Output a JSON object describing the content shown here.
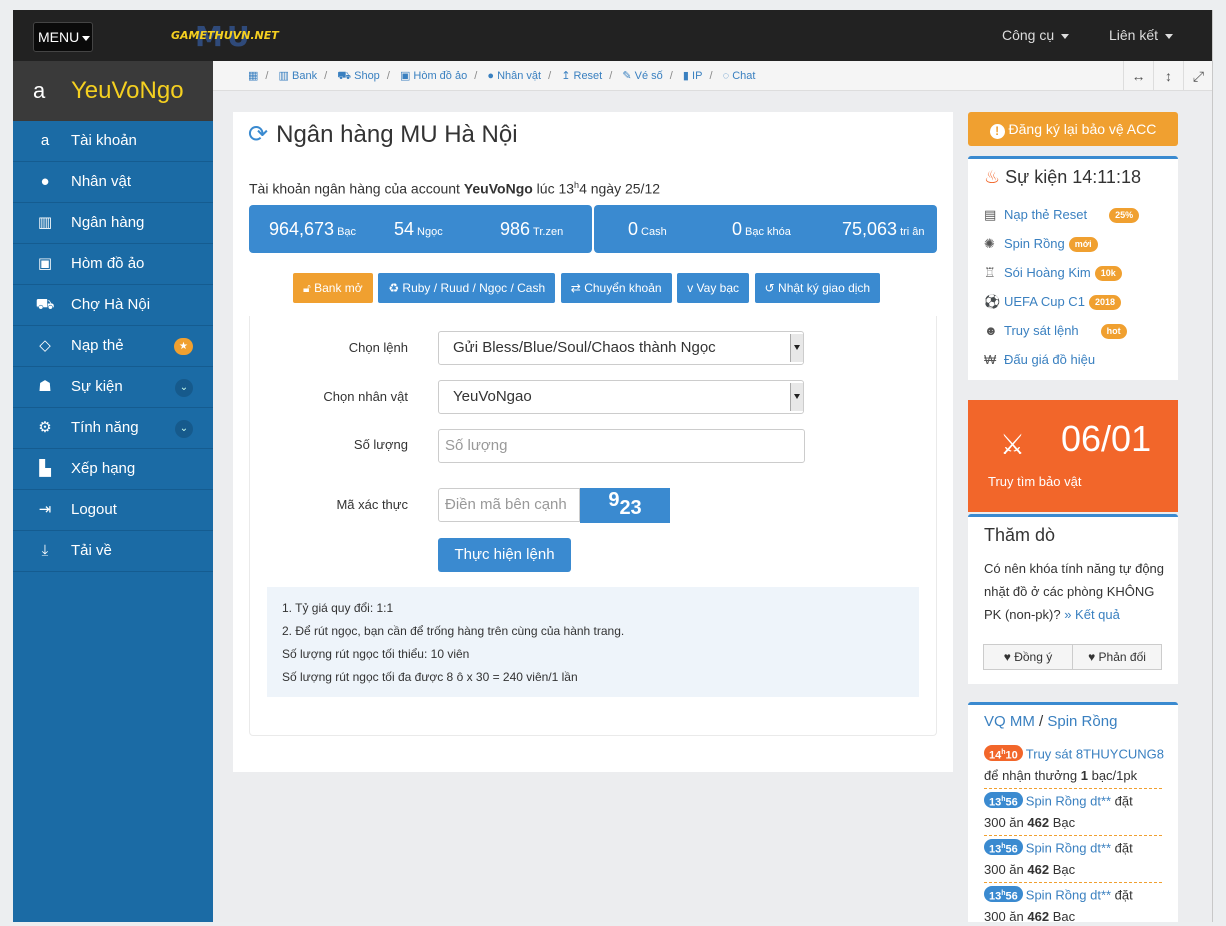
{
  "topbar": {
    "menu_label": "MENU",
    "logo_big": "MU",
    "logo_small": "GAMETHUVN.NET",
    "nav": [
      "Công cụ",
      "Liên kết"
    ]
  },
  "sidebar": {
    "username": "YeuVoNgo",
    "items": [
      {
        "label": "Tài khoản",
        "icon": "user-icon"
      },
      {
        "label": "Nhân vật",
        "icon": "person-icon"
      },
      {
        "label": "Ngân hàng",
        "icon": "bank-icon"
      },
      {
        "label": "Hòm đồ ảo",
        "icon": "briefcase-icon"
      },
      {
        "label": "Chợ Hà Nội",
        "icon": "cart-icon"
      },
      {
        "label": "Nạp thẻ",
        "icon": "diamond-icon"
      },
      {
        "label": "Sự kiện",
        "icon": "android-icon"
      },
      {
        "label": "Tính năng",
        "icon": "gears-icon"
      },
      {
        "label": "Xếp hạng",
        "icon": "bar-chart-icon"
      },
      {
        "label": "Logout",
        "icon": "sign-out-icon"
      },
      {
        "label": "Tải về",
        "icon": "download-icon"
      }
    ]
  },
  "breadcrumb": [
    "Bank",
    "Shop",
    "Hòm đồ ảo",
    "Nhân vật",
    "Reset",
    "Vé số",
    "IP",
    "Chat"
  ],
  "main": {
    "title": "Ngân hàng MU Hà Nội",
    "account_prefix": "Tài khoản ngân hàng của account ",
    "account_name": "YeuVoNgo",
    "account_time": " lúc 13",
    "account_time_sup": "h",
    "account_time_rest": "4 ngày 25/12",
    "stats": [
      {
        "value": "964,673",
        "unit": "Bạc"
      },
      {
        "value": "54",
        "unit": "Ngọc"
      },
      {
        "value": "986",
        "unit": "Tr.zen"
      },
      {
        "value": "0",
        "unit": "Cash"
      },
      {
        "value": "0",
        "unit": "Bạc khóa"
      },
      {
        "value": "75,063",
        "unit": "tri ân"
      }
    ],
    "buttons": [
      "Bank mở",
      "Ruby / Ruud / Ngọc / Cash",
      "Chuyển khoản",
      "Vay bạc",
      "Nhật ký giao dịch"
    ],
    "form": {
      "command_label": "Chọn lệnh",
      "command_value": "Gửi Bless/Blue/Soul/Chaos thành Ngọc",
      "char_label": "Chọn nhân vật",
      "char_value": "YeuVoNgao",
      "qty_label": "Số lượng",
      "qty_placeholder": "Số lượng",
      "captcha_label": "Mã xác thực",
      "captcha_placeholder": "Điền mã bên cạnh",
      "captcha_a": "9",
      "captcha_b": "23",
      "submit": "Thực hiện lệnh"
    },
    "notes": [
      "1. Tỷ giá quy đổi: 1:1",
      "2. Để rút ngọc, bạn cần để trống hàng trên cùng của hành trang.",
      "Số lượng rút ngọc tối thiểu: 10 viên",
      "Số lượng rút ngọc tối đa được 8 ô x 30 = 240 viên/1 lần"
    ]
  },
  "right": {
    "protect_btn": "Đăng ký lại bảo vệ ACC",
    "events_title": "Sự kiện 14:11:18",
    "events": [
      {
        "label": "Nạp thẻ Reset",
        "badge": "25%"
      },
      {
        "label": "Spin Rồng",
        "badge": "mới"
      },
      {
        "label": "Sói Hoàng Kim",
        "badge": "10k"
      },
      {
        "label": "UEFA Cup C1",
        "badge": "2018"
      },
      {
        "label": "Truy sát lệnh",
        "badge": "hot"
      },
      {
        "label": "Đấu giá đồ hiệu",
        "badge": ""
      }
    ],
    "treasure_date": "06/01",
    "treasure_label": "Truy tìm bảo vật",
    "poll_title": "Thăm dò",
    "poll_question": "Có nên khóa tính năng tự động nhặt đồ ở các phòng KHÔNG PK (non-pk)?",
    "poll_result": "» Kết quả",
    "poll_yes": "Đồng ý",
    "poll_no": "Phản đối",
    "vq_title_a": "VQ MM",
    "vq_sep": " / ",
    "vq_title_b": "Spin Rồng",
    "log": [
      {
        "time": "14",
        "time_sup": "h",
        "time_rest": "10",
        "link": "Truy sát 8THUYCUNG8",
        "text_a": "để nhận thưởng ",
        "bold": "1",
        "text_b": " bạc/1pk"
      },
      {
        "time": "13",
        "time_sup": "h",
        "time_rest": "56",
        "link": "Spin Rồng dt**",
        "link_tail": " đặt",
        "text_a": "300 ăn ",
        "bold": "462",
        "text_b": " Bạc"
      },
      {
        "time": "13",
        "time_sup": "h",
        "time_rest": "56",
        "link": "Spin Rồng dt**",
        "link_tail": " đặt",
        "text_a": "300 ăn ",
        "bold": "462",
        "text_b": " Bạc"
      },
      {
        "time": "13",
        "time_sup": "h",
        "time_rest": "56",
        "link": "Spin Rồng dt**",
        "link_tail": " đặt",
        "text_a": "300 ăn ",
        "bold": "462",
        "text_b": " Bạc"
      }
    ]
  },
  "colors": {
    "primary": "#3a8ad0",
    "sidebar": "#1b6ba5",
    "accent": "#f0a030",
    "red": "#f2662a"
  }
}
